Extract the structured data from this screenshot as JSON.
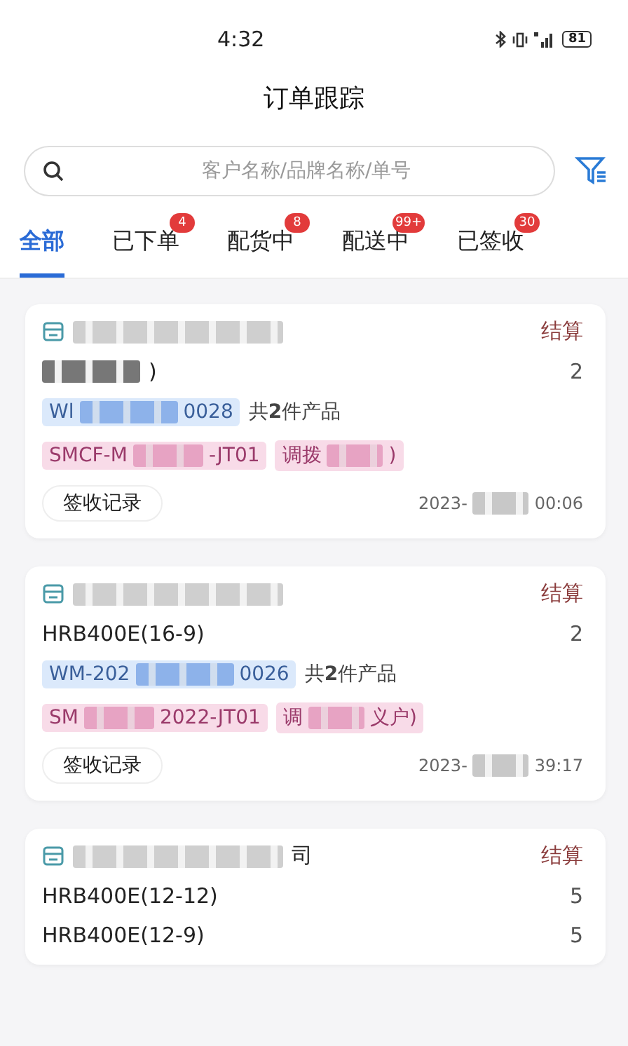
{
  "status_bar": {
    "time": "4:32",
    "battery": "81"
  },
  "title": "订单跟踪",
  "search": {
    "placeholder": "客户名称/品牌名称/单号"
  },
  "tabs": [
    {
      "label": "全部",
      "selected": true
    },
    {
      "label": "已下单",
      "selected": false,
      "badge": "4"
    },
    {
      "label": "配货中",
      "selected": false,
      "badge": "8"
    },
    {
      "label": "配送中",
      "selected": false,
      "badge": "99+"
    },
    {
      "label": "已签收",
      "selected": false,
      "badge": "30"
    }
  ],
  "orders": [
    {
      "status": "结算",
      "lines": [
        {
          "product": ")",
          "redacted": true,
          "qty": "2"
        }
      ],
      "code": {
        "before": "Wl",
        "after": "0028"
      },
      "summary": "共**2**件产品",
      "tags": [
        {
          "before": "SMCF-M",
          "after": "-JT01"
        },
        {
          "before": "调拨",
          "after": ")"
        }
      ],
      "button": "签收记录",
      "date": {
        "before": "2023-",
        "after": "00:06"
      }
    },
    {
      "status": "结算",
      "lines": [
        {
          "product": "HRB400E(16-9)",
          "redacted": false,
          "qty": "2"
        }
      ],
      "code": {
        "before": "WM-202",
        "after": "0026"
      },
      "summary": "共**2**件产品",
      "tags": [
        {
          "before": "SM",
          "after": "2022-JT01"
        },
        {
          "before": "调",
          "after": "义户)"
        }
      ],
      "button": "签收记录",
      "date": {
        "before": "2023-",
        "after": "39:17"
      }
    },
    {
      "store_suffix": "司",
      "status": "结算",
      "lines": [
        {
          "product": "HRB400E(12-12)",
          "redacted": false,
          "qty": "5"
        },
        {
          "product": "HRB400E(12-9)",
          "redacted": false,
          "qty": "5"
        }
      ]
    }
  ]
}
